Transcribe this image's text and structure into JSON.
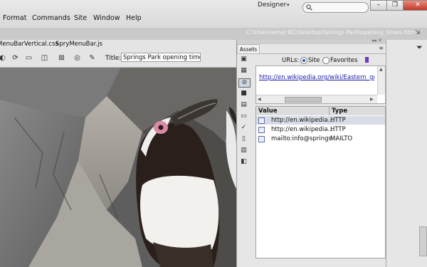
{
  "menu": {
    "items": [
      "Format",
      "Commands",
      "Site",
      "Window",
      "Help"
    ],
    "workspace": "Designer",
    "search_value": ""
  },
  "window_controls": {
    "minimize": "–",
    "restore": "❐",
    "close": "✕"
  },
  "doc_path": "C:\\Users\\amyr.BC\\Desktop\\Springs Park\\opening_times.html",
  "related_files": [
    "MenuBarVertical.css",
    "SpryMenuBar.js"
  ],
  "doc_toolbar": {
    "title_label": "Title:",
    "title_value": "Springs Park opening times pag"
  },
  "assets": {
    "tab_label": "Assets",
    "urls_label": "URLs:",
    "site_label": "Site",
    "favorites_label": "Favorites",
    "preview_url": "http://en.wikipedia.org/wiki/Eastern_grey_ka",
    "columns": [
      "Value",
      "Type"
    ],
    "rows": [
      {
        "value": "http://en.wikipedia...",
        "type": "HTTP"
      },
      {
        "value": "http://en.wikipedia...",
        "type": "HTTP"
      },
      {
        "value": "mailto:info@springs...",
        "type": "MAILTO"
      }
    ],
    "selected_row": 0
  },
  "colors": {
    "link": "#1a1aa8",
    "selection": "#d7dce6",
    "close_button": "#c0392b",
    "favorites_icon": "#6d3bbd"
  },
  "icons": [
    "search-icon",
    "code-view-icon",
    "split-view-icon",
    "design-view-icon",
    "live-view-icon",
    "filter-icon"
  ]
}
